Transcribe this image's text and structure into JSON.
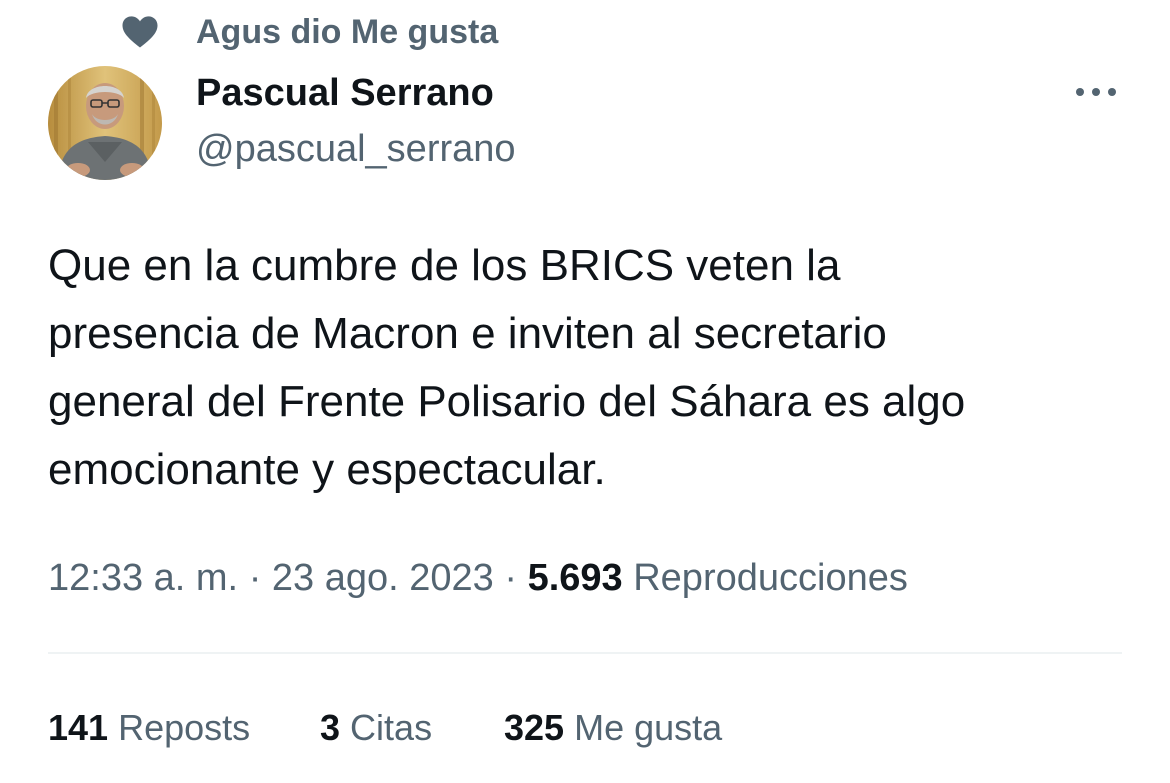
{
  "social_context": {
    "icon": "heart-icon",
    "text": "Agus dio Me gusta"
  },
  "author": {
    "display_name": "Pascual Serrano",
    "handle": "@pascual_serrano",
    "avatar": "avatar-photo"
  },
  "more_button": {
    "icon": "more-dots-icon"
  },
  "tweet": {
    "text": "Que en la cumbre de los BRICS veten la\npresencia de Macron e inviten al secretario\ngeneral del Frente Polisario del Sáhara es algo\nemocionante y espectacular."
  },
  "meta": {
    "time": "12:33 a. m.",
    "separator": "·",
    "date": "23 ago. 2023",
    "views_count": "5.693",
    "views_label": "Reproducciones"
  },
  "stats": {
    "reposts_count": "141",
    "reposts_label": "Reposts",
    "quotes_count": "3",
    "quotes_label": "Citas",
    "likes_count": "325",
    "likes_label": "Me gusta"
  },
  "colors": {
    "text_primary": "#0f1419",
    "text_secondary": "#536471",
    "divider": "#eff3f4"
  }
}
